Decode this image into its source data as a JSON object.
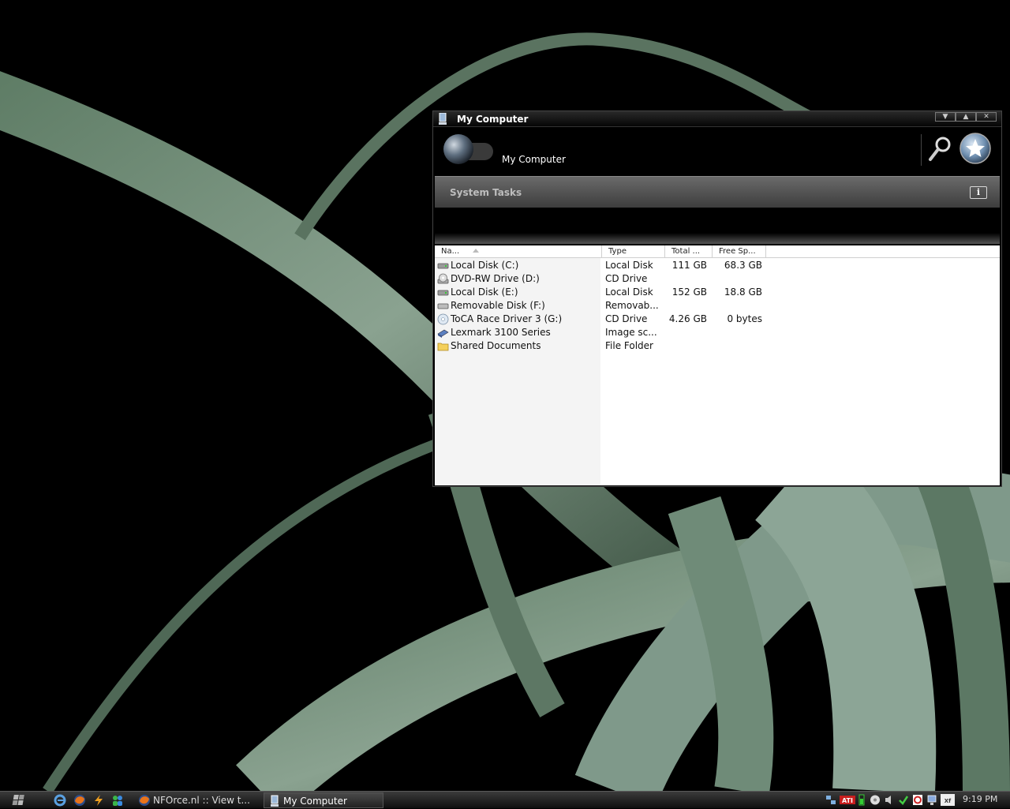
{
  "window": {
    "title": "My Computer",
    "header_title": "My Computer",
    "controls": [
      "minimize",
      "maximize",
      "close"
    ]
  },
  "tasks": {
    "title": "System Tasks",
    "info_icon": "info-icon"
  },
  "list": {
    "columns": [
      "Na...",
      "Type",
      "Total ...",
      "Free Sp..."
    ],
    "rows": [
      {
        "name": "Local Disk (C:)",
        "type": "Local Disk",
        "total": "111 GB",
        "free": "68.3 GB",
        "icon": "hard-disk-icon"
      },
      {
        "name": "DVD-RW Drive (D:)",
        "type": "CD Drive",
        "total": "",
        "free": "",
        "icon": "dvd-drive-icon"
      },
      {
        "name": "Local Disk (E:)",
        "type": "Local Disk",
        "total": "152 GB",
        "free": "18.8 GB",
        "icon": "hard-disk-icon"
      },
      {
        "name": "Removable Disk (F:)",
        "type": "Removab...",
        "total": "",
        "free": "",
        "icon": "removable-disk-icon"
      },
      {
        "name": "ToCA Race Driver 3 (G:)",
        "type": "CD Drive",
        "total": "4.26 GB",
        "free": "0 bytes",
        "icon": "cd-disc-icon"
      },
      {
        "name": "Lexmark 3100 Series",
        "type": "Image sc...",
        "total": "",
        "free": "",
        "icon": "scanner-icon"
      },
      {
        "name": "Shared Documents",
        "type": "File Folder",
        "total": "",
        "free": "",
        "icon": "folder-icon"
      }
    ]
  },
  "taskbar": {
    "tasks": [
      {
        "label": "NFOrce.nl :: View t...",
        "icon": "firefox-icon"
      },
      {
        "label": "My Computer",
        "icon": "my-computer-icon"
      }
    ],
    "quick_launch": [
      "ie-icon",
      "firefox-icon",
      "winamp-icon",
      "messenger-icon"
    ],
    "tray_icons": [
      "network-icon",
      "ati-icon",
      "volume-meter-icon",
      "disc-icon",
      "speaker-icon",
      "security-icon",
      "antivirus-icon",
      "network-activity-icon",
      "xfire-icon"
    ],
    "clock": "9:19 PM"
  },
  "colors": {
    "wallpaper": "#000000",
    "vine": "#6e8a74",
    "window_bg": "#000000",
    "tasks_bar": "#555555",
    "list_bg": "#ffffff"
  }
}
